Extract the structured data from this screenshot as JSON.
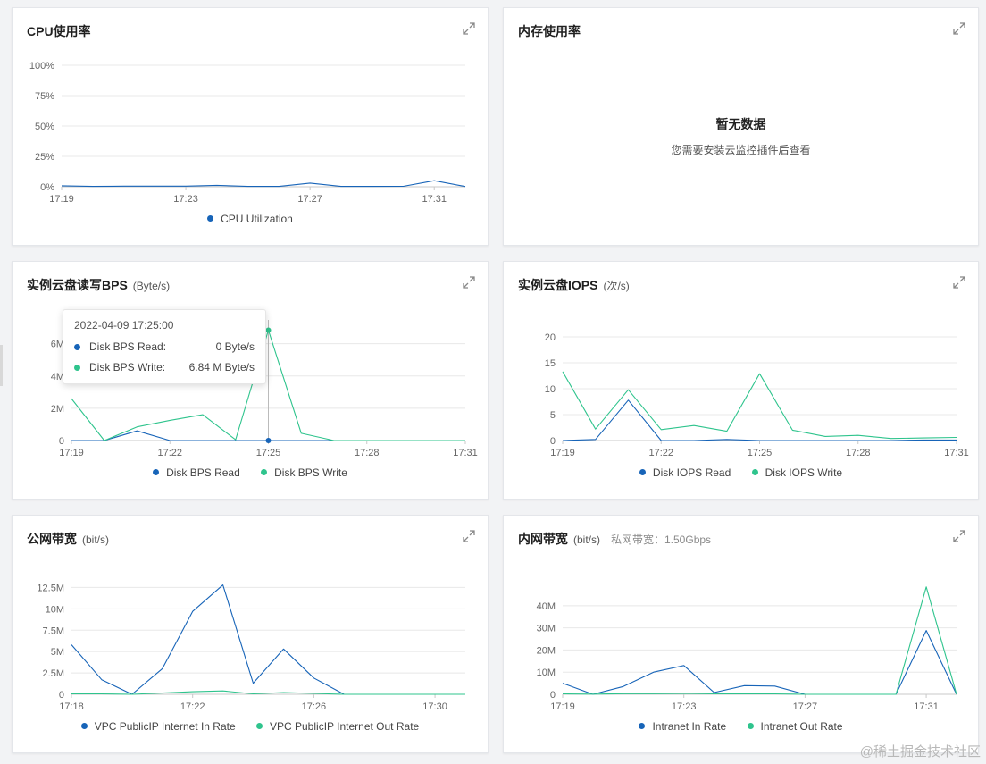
{
  "colors": {
    "read": "#1764b8",
    "write": "#2fc48d",
    "grid": "#e8e8e8",
    "axis": "#c8c8c8"
  },
  "cards": {
    "cpu": {
      "title": "CPU使用率",
      "legend": [
        "CPU Utilization"
      ]
    },
    "mem": {
      "title": "内存使用率",
      "nodata_title": "暂无数据",
      "nodata_desc": "您需要安装云监控插件后查看"
    },
    "disk_bps": {
      "title": "实例云盘读写BPS",
      "unit": "(Byte/s)",
      "legend": [
        "Disk BPS Read",
        "Disk BPS Write"
      ]
    },
    "disk_iops": {
      "title": "实例云盘IOPS",
      "unit": "(次/s)",
      "legend": [
        "Disk IOPS Read",
        "Disk IOPS Write"
      ]
    },
    "public_bw": {
      "title": "公网带宽",
      "unit": "(bit/s)",
      "legend": [
        "VPC PublicIP Internet In Rate",
        "VPC PublicIP Internet Out Rate"
      ]
    },
    "intranet_bw": {
      "title": "内网带宽",
      "unit": "(bit/s)",
      "extra": "私网带宽：1.50Gbps",
      "legend": [
        "Intranet In Rate",
        "Intranet Out Rate"
      ]
    }
  },
  "tooltip": {
    "time": "2022-04-09 17:25:00",
    "rows": [
      {
        "label": "Disk BPS Read:",
        "value": "0 Byte/s"
      },
      {
        "label": "Disk BPS Write:",
        "value": "6.84 M Byte/s"
      }
    ]
  },
  "watermark": "@稀土掘金技术社区",
  "chart_data": [
    {
      "id": "cpu",
      "type": "line",
      "x": [
        "17:19",
        "17:20",
        "17:21",
        "17:22",
        "17:23",
        "17:24",
        "17:25",
        "17:26",
        "17:27",
        "17:28",
        "17:29",
        "17:30",
        "17:31",
        "17:32"
      ],
      "x_ticks": [
        "17:19",
        "17:23",
        "17:27",
        "17:31"
      ],
      "y_ticks": [
        "0%",
        "25%",
        "50%",
        "75%",
        "100%"
      ],
      "ylim": [
        0,
        100
      ],
      "series": [
        {
          "name": "CPU Utilization",
          "color": "#1764b8",
          "values": [
            0.8,
            0.3,
            0.5,
            0.5,
            0.5,
            1.2,
            0.3,
            0.3,
            3.0,
            0.3,
            0.3,
            0.4,
            5.0,
            0.2
          ]
        }
      ]
    },
    {
      "id": "disk_bps",
      "type": "line",
      "x": [
        "17:19",
        "17:20",
        "17:21",
        "17:22",
        "17:23",
        "17:24",
        "17:25",
        "17:26",
        "17:27",
        "17:28",
        "17:29",
        "17:30",
        "17:31"
      ],
      "x_ticks": [
        "17:19",
        "17:22",
        "17:25",
        "17:28",
        "17:31"
      ],
      "y_ticks": [
        "0",
        "2M",
        "4M",
        "6M"
      ],
      "ylim": [
        0,
        7.2
      ],
      "series": [
        {
          "name": "Disk BPS Read",
          "color": "#1764b8",
          "values": [
            0,
            0,
            0.6,
            0,
            0,
            0,
            0,
            0,
            0,
            0,
            0,
            0,
            0
          ]
        },
        {
          "name": "Disk BPS Write",
          "color": "#2fc48d",
          "values": [
            2.6,
            0,
            0.85,
            1.25,
            1.6,
            0.05,
            6.84,
            0.45,
            0,
            0,
            0,
            0,
            0
          ]
        }
      ],
      "hover_index": 6
    },
    {
      "id": "disk_iops",
      "type": "line",
      "x": [
        "17:19",
        "17:20",
        "17:21",
        "17:22",
        "17:23",
        "17:24",
        "17:25",
        "17:26",
        "17:27",
        "17:28",
        "17:29",
        "17:30",
        "17:31"
      ],
      "x_ticks": [
        "17:19",
        "17:22",
        "17:25",
        "17:28",
        "17:31"
      ],
      "y_ticks": [
        "0",
        "5",
        "10",
        "15",
        "20"
      ],
      "ylim": [
        0,
        20
      ],
      "series": [
        {
          "name": "Disk IOPS Read",
          "color": "#1764b8",
          "values": [
            0,
            0.2,
            7.8,
            0,
            0,
            0.2,
            0,
            0,
            0,
            0,
            0,
            0.1,
            0.1
          ]
        },
        {
          "name": "Disk IOPS Write",
          "color": "#2fc48d",
          "values": [
            13.3,
            2.2,
            9.8,
            2.1,
            2.9,
            1.8,
            12.9,
            2.0,
            0.8,
            1.0,
            0.4,
            0.5,
            0.6
          ]
        }
      ]
    },
    {
      "id": "public_bw",
      "type": "line",
      "x": [
        "17:18",
        "17:19",
        "17:20",
        "17:21",
        "17:22",
        "17:23",
        "17:24",
        "17:25",
        "17:26",
        "17:27",
        "17:28",
        "17:29",
        "17:30",
        "17:31"
      ],
      "x_ticks": [
        "17:18",
        "17:22",
        "17:26",
        "17:30"
      ],
      "y_ticks": [
        "0",
        "2.5M",
        "5M",
        "7.5M",
        "10M",
        "12.5M"
      ],
      "ylim": [
        0,
        13.8
      ],
      "series": [
        {
          "name": "VPC PublicIP Internet In Rate",
          "color": "#1764b8",
          "values": [
            5.8,
            1.7,
            0,
            3.0,
            9.7,
            12.8,
            1.3,
            5.3,
            1.9,
            0,
            0,
            0,
            0,
            0
          ]
        },
        {
          "name": "VPC PublicIP Internet Out Rate",
          "color": "#2fc48d",
          "values": [
            0.05,
            0.05,
            0,
            0.15,
            0.3,
            0.4,
            0.05,
            0.2,
            0.1,
            0,
            0,
            0,
            0,
            0
          ]
        }
      ]
    },
    {
      "id": "intranet_bw",
      "type": "line",
      "x": [
        "17:19",
        "17:20",
        "17:21",
        "17:22",
        "17:23",
        "17:24",
        "17:25",
        "17:26",
        "17:27",
        "17:28",
        "17:29",
        "17:30",
        "17:31",
        "17:32"
      ],
      "x_ticks": [
        "17:19",
        "17:23",
        "17:27",
        "17:31"
      ],
      "y_ticks": [
        "0",
        "10M",
        "20M",
        "30M",
        "40M"
      ],
      "ylim": [
        0,
        46
      ],
      "series": [
        {
          "name": "Intranet In Rate",
          "color": "#1764b8",
          "values": [
            5.0,
            0,
            3.5,
            10.0,
            13.0,
            0.8,
            3.9,
            3.7,
            0,
            0,
            0,
            0,
            28.8,
            0
          ]
        },
        {
          "name": "Intranet Out Rate",
          "color": "#2fc48d",
          "values": [
            0.2,
            0.1,
            0.3,
            0.3,
            0.4,
            0.2,
            0.2,
            0.2,
            0,
            0,
            0,
            0,
            48.5,
            0
          ]
        }
      ]
    }
  ]
}
